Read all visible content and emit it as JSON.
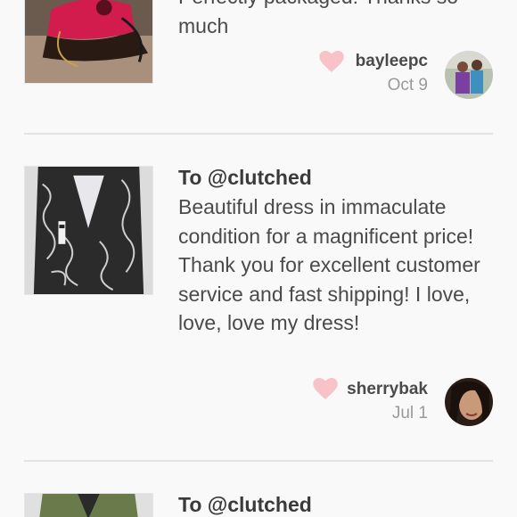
{
  "reviews": [
    {
      "message_tail": "Perfectly packaged! Thanks so much",
      "username": "bayleepc",
      "date": "Oct 9",
      "like_icon": "heart-icon"
    },
    {
      "recipient": "To @clutched",
      "message": "Beautiful dress in immaculate condition for a magnificent price! Thank you for excellent customer service and fast shipping! I love, love, love my dress!",
      "username": "sherrybak",
      "date": "Jul 1",
      "like_icon": "heart-icon"
    },
    {
      "recipient": "To @clutched"
    }
  ],
  "colors": {
    "heart": "#f7c3c8",
    "divider": "#e3e3e3",
    "background": "#f9f9f9"
  }
}
